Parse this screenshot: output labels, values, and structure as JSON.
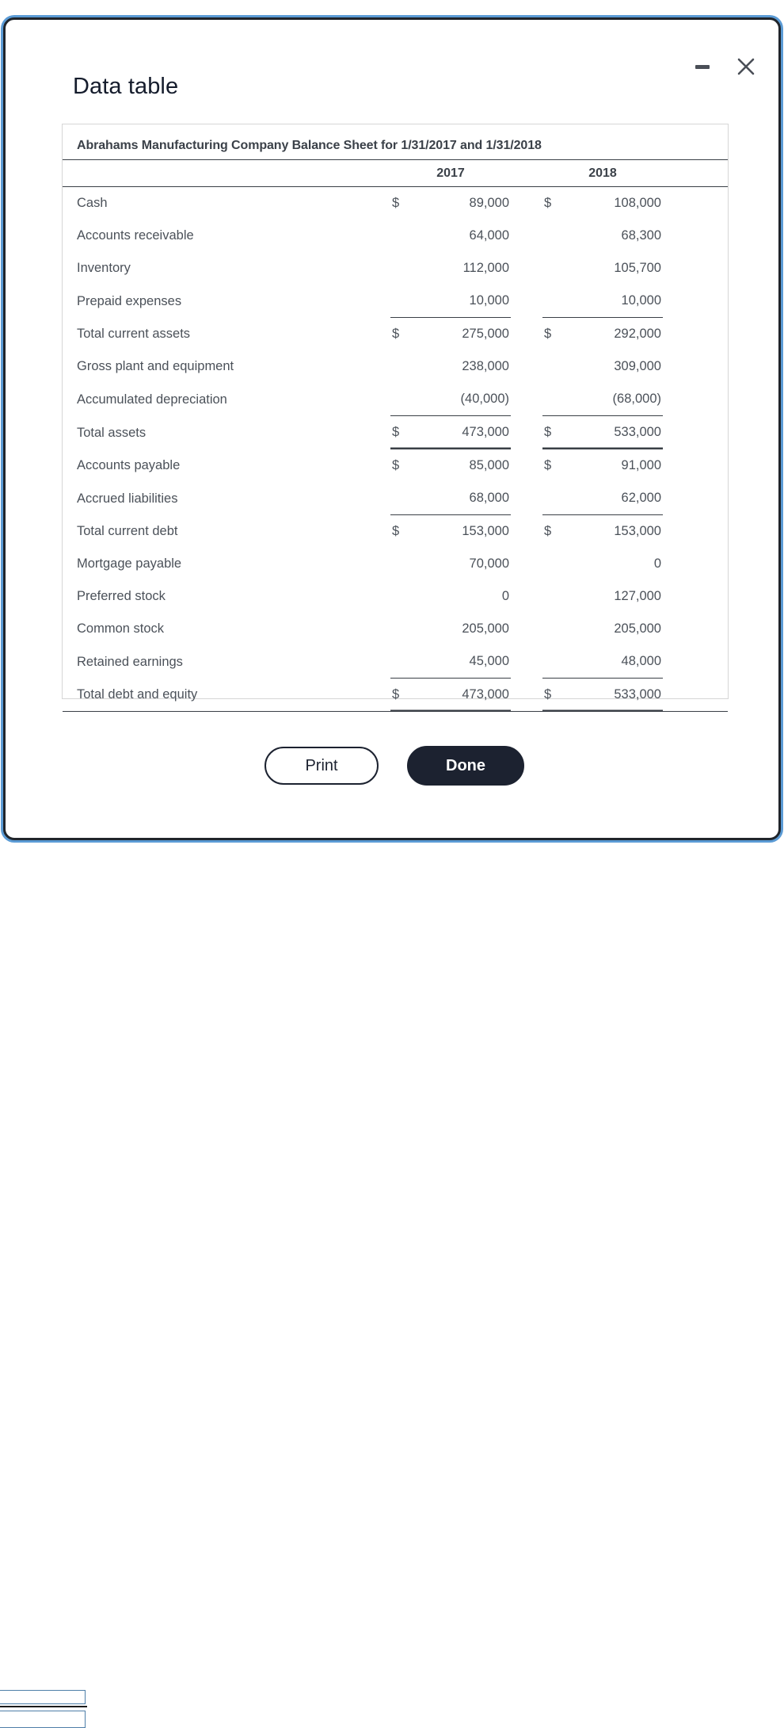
{
  "window": {
    "title": "Data table",
    "minimize_icon": "minimize-icon",
    "close_icon": "close-icon",
    "accent_color": "#5b9bd5",
    "border_color": "#20252b"
  },
  "table": {
    "caption": "Abrahams Manufacturing Company Balance Sheet for 1/31/2017 and 1/31/2018",
    "columns": [
      "",
      "2017",
      "2018"
    ],
    "rows": [
      {
        "label": "Cash",
        "c1": "$",
        "v1": "89,000",
        "c2": "$",
        "v2": "108,000",
        "rule": "none"
      },
      {
        "label": "Accounts receivable",
        "c1": "",
        "v1": "64,000",
        "c2": "",
        "v2": "68,300",
        "rule": "none"
      },
      {
        "label": "Inventory",
        "c1": "",
        "v1": "112,000",
        "c2": "",
        "v2": "105,700",
        "rule": "none"
      },
      {
        "label": "Prepaid expenses",
        "c1": "",
        "v1": "10,000",
        "c2": "",
        "v2": "10,000",
        "rule": "single"
      },
      {
        "label": "Total current assets",
        "c1": "$",
        "v1": "275,000",
        "c2": "$",
        "v2": "292,000",
        "rule": "none"
      },
      {
        "label": "Gross plant and equipment",
        "c1": "",
        "v1": "238,000",
        "c2": "",
        "v2": "309,000",
        "rule": "none"
      },
      {
        "label": "Accumulated depreciation",
        "c1": "",
        "v1": "(40,000)",
        "c2": "",
        "v2": "(68,000)",
        "rule": "single"
      },
      {
        "label": "Total assets",
        "c1": "$",
        "v1": "473,000",
        "c2": "$",
        "v2": "533,000",
        "rule": "double"
      },
      {
        "label": "Accounts payable",
        "c1": "$",
        "v1": "85,000",
        "c2": "$",
        "v2": "91,000",
        "rule": "none"
      },
      {
        "label": "Accrued liabilities",
        "c1": "",
        "v1": "68,000",
        "c2": "",
        "v2": "62,000",
        "rule": "single"
      },
      {
        "label": "Total current debt",
        "c1": "$",
        "v1": "153,000",
        "c2": "$",
        "v2": "153,000",
        "rule": "none"
      },
      {
        "label": "Mortgage payable",
        "c1": "",
        "v1": "70,000",
        "c2": "",
        "v2": "0",
        "rule": "none"
      },
      {
        "label": "Preferred stock",
        "c1": "",
        "v1": "0",
        "c2": "",
        "v2": "127,000",
        "rule": "none"
      },
      {
        "label": "Common stock",
        "c1": "",
        "v1": "205,000",
        "c2": "",
        "v2": "205,000",
        "rule": "none"
      },
      {
        "label": "Retained earnings",
        "c1": "",
        "v1": "45,000",
        "c2": "",
        "v2": "48,000",
        "rule": "single"
      },
      {
        "label": "Total debt and equity",
        "c1": "$",
        "v1": "473,000",
        "c2": "$",
        "v2": "533,000",
        "rule": "double"
      }
    ]
  },
  "footer": {
    "print_label": "Print",
    "done_label": "Done"
  }
}
